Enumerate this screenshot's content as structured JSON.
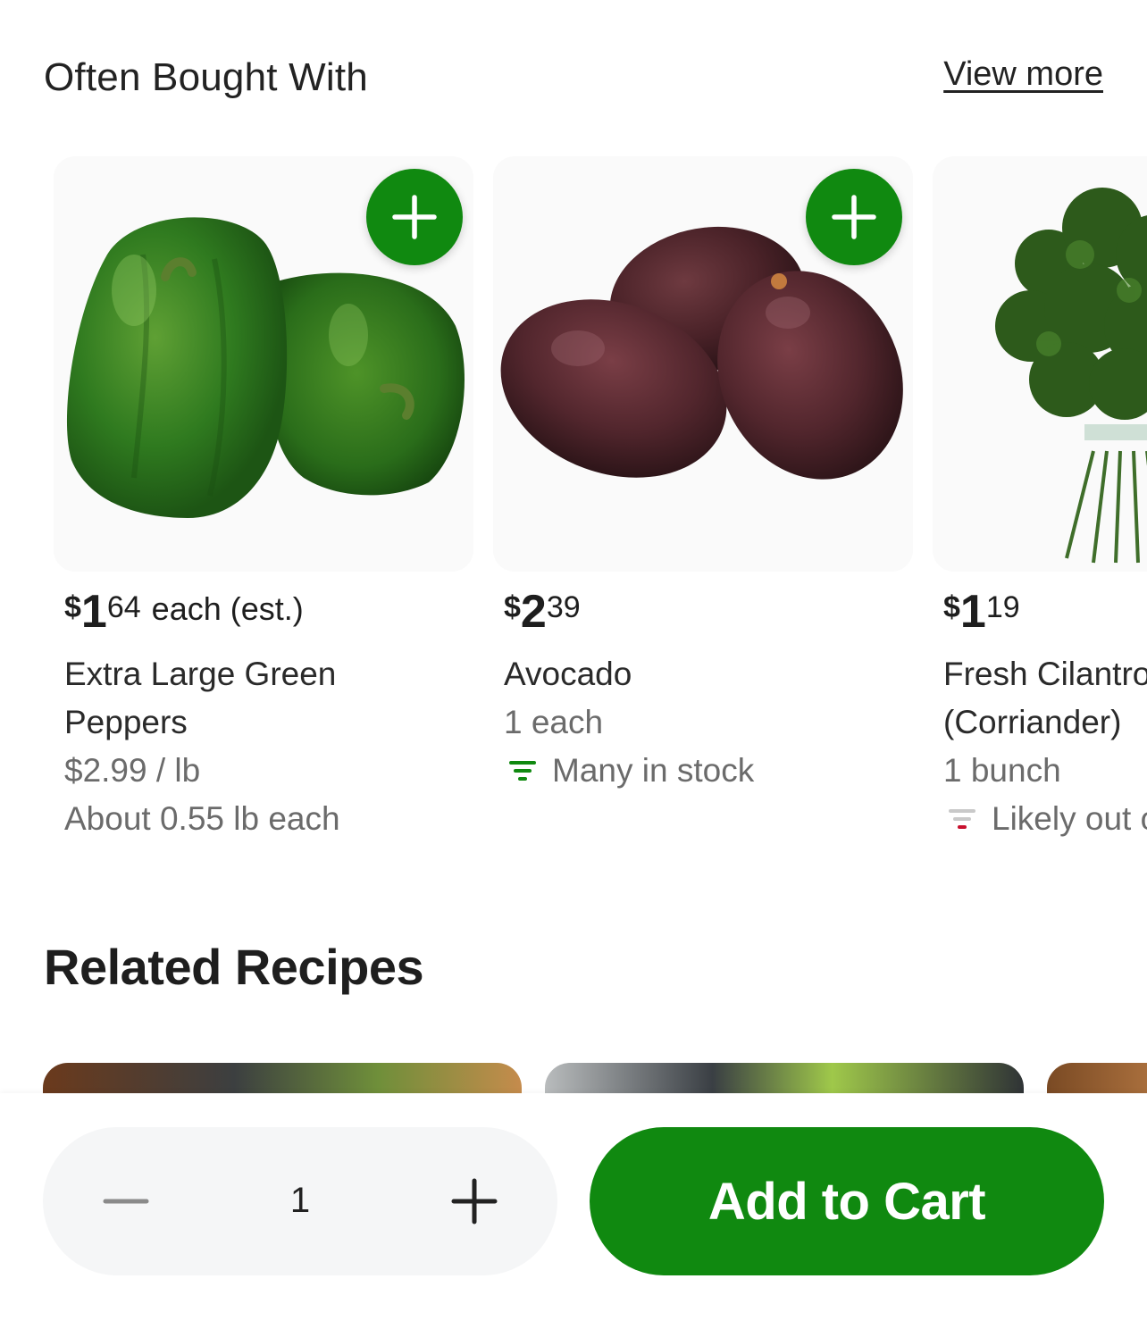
{
  "often_bought": {
    "title": "Often Bought With",
    "view_more": "View more",
    "products": [
      {
        "price_currency": "$",
        "price_dollars": "1",
        "price_cents": "64",
        "price_suffix": "each (est.)",
        "name": "Extra Large Green Peppers",
        "unit_price": "$2.99 / lb",
        "weight": "About 0.55 lb each"
      },
      {
        "price_currency": "$",
        "price_dollars": "2",
        "price_cents": "39",
        "name": "Avocado",
        "quantity": "1 each",
        "stock": "Many in stock"
      },
      {
        "price_currency": "$",
        "price_dollars": "1",
        "price_cents": "19",
        "name": "Fresh Cilantro (Corriander)",
        "quantity": "1 bunch",
        "stock": "Likely out of stock"
      }
    ]
  },
  "related_recipes": {
    "title": "Related Recipes"
  },
  "bottom_bar": {
    "quantity": "1",
    "add_to_cart": "Add to Cart"
  },
  "colors": {
    "brand_green": "#108910",
    "in_stock_green": "#108910",
    "out_of_stock_red": "#c8102e"
  }
}
